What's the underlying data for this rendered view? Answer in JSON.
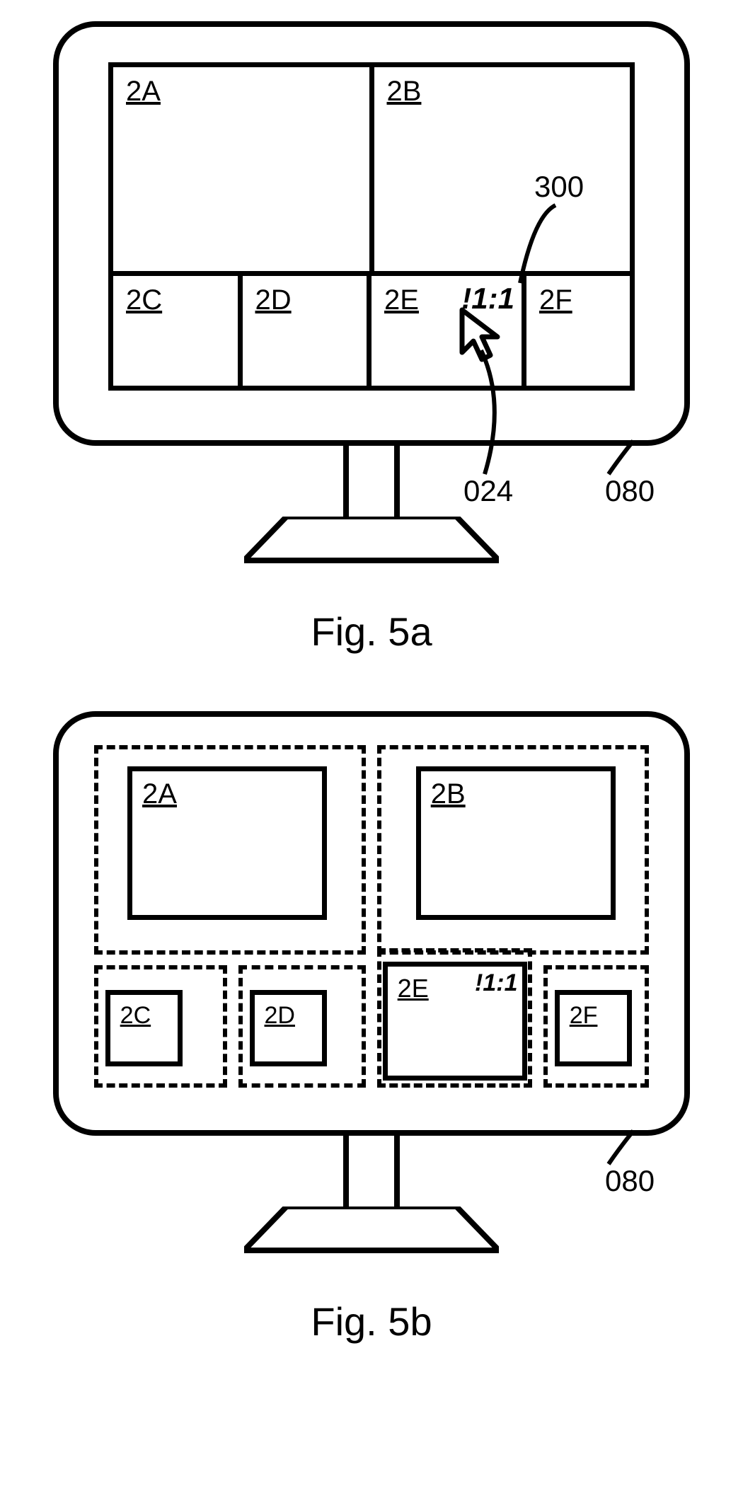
{
  "figures": {
    "a": {
      "caption": "Fig. 5a",
      "monitor_ref": "080",
      "pointer_ref": "024",
      "badge_callout": "300",
      "cells": {
        "c2a": "2A",
        "c2b": "2B",
        "c2c": "2C",
        "c2d": "2D",
        "c2e": "2E",
        "c2f": "2F"
      },
      "ratio_badge": "!1:1"
    },
    "b": {
      "caption": "Fig. 5b",
      "monitor_ref": "080",
      "cells": {
        "c2a": "2A",
        "c2b": "2B",
        "c2c": "2C",
        "c2d": "2D",
        "c2e": "2E",
        "c2f": "2F"
      },
      "ratio_badge": "!1:1"
    }
  }
}
